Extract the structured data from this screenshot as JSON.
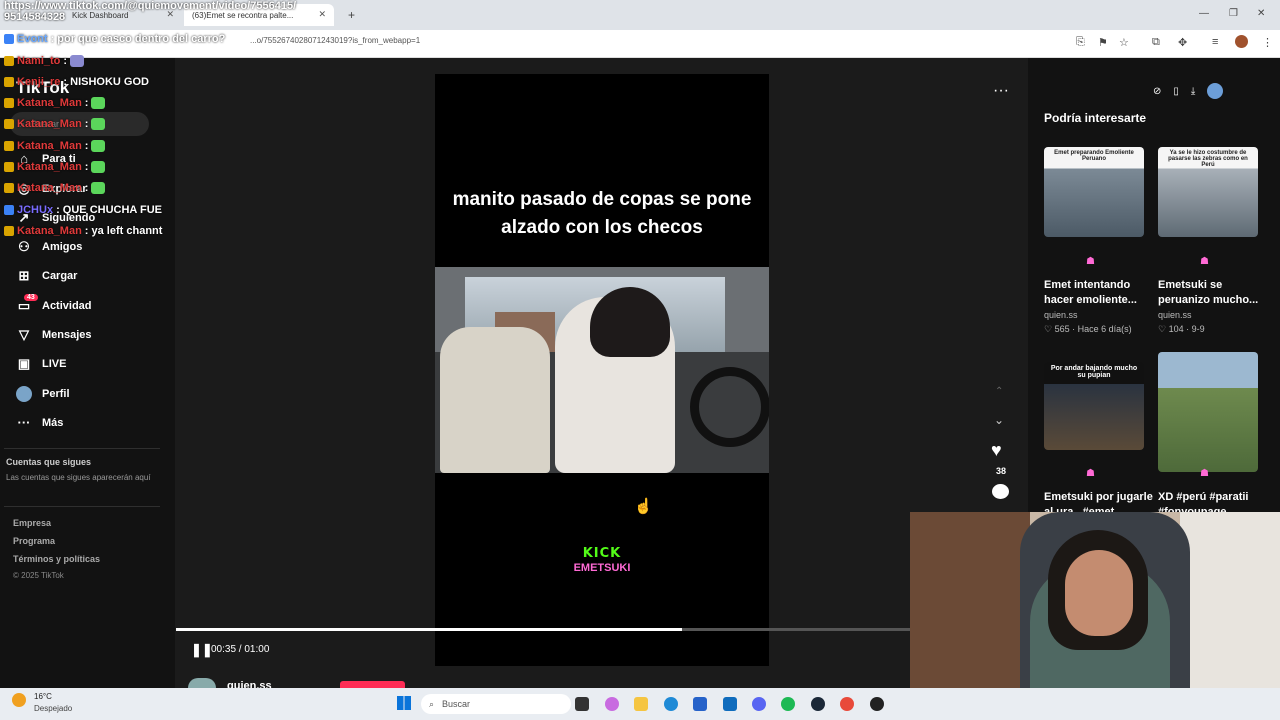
{
  "browser": {
    "tabs": [
      {
        "label": "Kick Dashboard"
      },
      {
        "label": "(63)Emet se recontra palte..."
      }
    ],
    "url": "...o/7552674028071243019?is_from_webapp=1",
    "overlay_url": "https://www.tiktok.com/@quiemovement/video/7556415/"
  },
  "stream_overlay": {
    "phone": "9514584328",
    "event_label": "Evont",
    "event_text": ": por que casco dentro del carro?",
    "messages": [
      {
        "user": "Nami_to",
        "text": ":"
      },
      {
        "user": "Kenji_re",
        "text": ": NISHOKU GOD"
      },
      {
        "user": "Katana_Man",
        "text": ":"
      },
      {
        "user": "Katana_Man",
        "text": ":"
      },
      {
        "user": "Katana_Man",
        "text": ":"
      },
      {
        "user": "Katana_Man",
        "text": ":"
      },
      {
        "user": "Katana_Man",
        "text": ":"
      },
      {
        "user": "JCHUx",
        "text": ": QUE CHUCHA FUE"
      },
      {
        "user": "Katana_Man",
        "text": ": ya left channt"
      }
    ]
  },
  "sidebar": {
    "logo": "TikTok",
    "search_placeholder": "Buscar",
    "items": [
      {
        "label": "Para ti",
        "icon": "home-icon"
      },
      {
        "label": "Explorar",
        "icon": "compass-icon"
      },
      {
        "label": "Siguiendo",
        "icon": "following-icon"
      },
      {
        "label": "Amigos",
        "icon": "friends-icon"
      },
      {
        "label": "Cargar",
        "icon": "upload-icon"
      },
      {
        "label": "Actividad",
        "icon": "activity-icon",
        "badge": "43"
      },
      {
        "label": "Mensajes",
        "icon": "messages-icon"
      },
      {
        "label": "LIVE",
        "icon": "live-icon"
      },
      {
        "label": "Perfil",
        "icon": "profile-icon"
      },
      {
        "label": "Más",
        "icon": "more-icon"
      }
    ],
    "following_heading": "Cuentas que sigues",
    "following_note": "Las cuentas que sigues aparecerán aquí",
    "footer_links": [
      "Empresa",
      "Programa",
      "Términos y políticas"
    ],
    "copyright": "© 2025 TikTok"
  },
  "video": {
    "caption": "manito pasado de copas se pone alzado con los checos",
    "watermark_top": "KICK",
    "watermark_bottom": "EMETSUKI",
    "time_current": "00:35",
    "time_total": "01:00",
    "time_separator": " / ",
    "progress": 0.69,
    "author": "quien.ss",
    "likes": "38"
  },
  "recommendations": {
    "heading": "Podría interesarte",
    "cards": [
      {
        "thumb_caption": "Emet preparando Emoliente Peruano",
        "title": "Emet intentando hacer emoliente...",
        "author": "quien.ss",
        "meta": "♡ 565 · Hace 6 día(s)"
      },
      {
        "thumb_caption": "Ya se le hizo costumbre de pasarse las zebras como en Perú",
        "title": "Emetsuki se peruanizo mucho...",
        "author": "quien.ss",
        "meta": "♡ 104 · 9-9"
      },
      {
        "thumb_caption": "Por andar bajando mucho su pupian",
        "title": "Emetsuki por jugarle al ura...#emet",
        "author": "",
        "meta": ""
      },
      {
        "thumb_caption": "",
        "title": "XD #perú #paratii #fonyoupage",
        "author": "",
        "meta": ""
      }
    ]
  },
  "taskbar": {
    "weather_temp": "16°C",
    "weather_desc": "Despejado",
    "search_placeholder": "Buscar"
  }
}
